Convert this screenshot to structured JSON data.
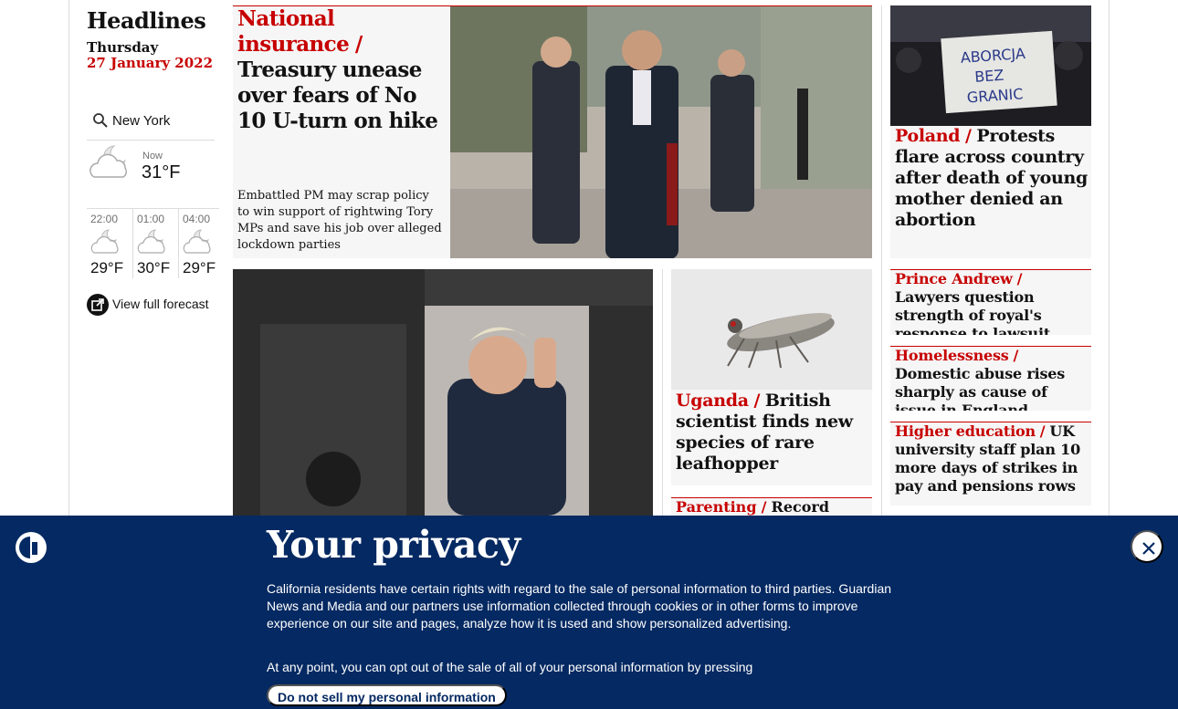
{
  "sidebar": {
    "title": "Headlines",
    "day": "Thursday",
    "date": "27 January 2022",
    "weather": {
      "location": "New York",
      "now_label": "Now",
      "now_temp": "31°F",
      "forecast": [
        {
          "time": "22:00",
          "temp": "29°F",
          "icon": "cloudy-night-icon"
        },
        {
          "time": "01:00",
          "temp": "30°F",
          "icon": "cloudy-night-icon"
        },
        {
          "time": "04:00",
          "temp": "29°F",
          "icon": "cloudy-night-icon"
        }
      ],
      "full_forecast_label": "View full forecast"
    }
  },
  "stories": {
    "lead": {
      "kicker": "National insurance",
      "headline": "Treasury unease over fears of No 10 U-turn on hike",
      "standfirst": "Embattled PM may scrap policy to win support of rightwing Tory MPs and save his job over alleged lockdown parties"
    },
    "uganda": {
      "kicker": "Uganda",
      "headline": "British scientist finds new species of rare leafhopper"
    },
    "parenting": {
      "kicker": "Parenting",
      "headline": "Record"
    },
    "poland": {
      "kicker": "Poland",
      "headline": "Protests flare across country after death of young mother denied an abortion"
    },
    "prince": {
      "kicker": "Prince Andrew",
      "headline": "Lawyers question strength of royal's response to lawsuit"
    },
    "homeless": {
      "kicker": "Homelessness",
      "headline": "Domestic abuse rises sharply as cause of issue in England"
    },
    "highered": {
      "kicker": "Higher education",
      "headline": "UK university staff plan 10 more days of strikes in pay and pensions rows"
    },
    "sign_text": "ABORCJA BEZ GRANIC"
  },
  "consent": {
    "title": "Your privacy",
    "body": "California residents have certain rights with regard to the sale of personal information to third parties. Guardian News and Media and our partners use information collected through cookies or in other forms to improve experience on our site and pages, analyze how it is used and show personalized advertising.",
    "body2": "At any point, you can opt out of the sale of all of your personal information by pressing",
    "button": "Do not sell my personal information"
  },
  "separator": "/",
  "colors": {
    "accent": "#c70000",
    "banner": "#052962",
    "card": "#f6f6f6"
  }
}
